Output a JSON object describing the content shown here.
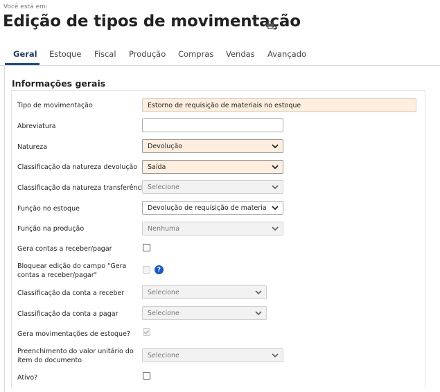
{
  "breadcrumb": "Você está em:",
  "page_title": "Edição de tipos de movimentação",
  "tabs": [
    {
      "label": "Geral"
    },
    {
      "label": "Estoque"
    },
    {
      "label": "Fiscal"
    },
    {
      "label": "Produção"
    },
    {
      "label": "Compras"
    },
    {
      "label": "Vendas"
    },
    {
      "label": "Avançado"
    }
  ],
  "section_title": "Informações gerais",
  "fields": {
    "tipo_movimentacao": {
      "label": "Tipo de movimentação",
      "value": "Estorno de requisição de materiais no estoque"
    },
    "abreviatura": {
      "label": "Abreviatura",
      "value": ""
    },
    "natureza": {
      "label": "Natureza",
      "value": "Devolução"
    },
    "class_natureza_devolucao": {
      "label": "Classificação da natureza devolução",
      "value": "Saída"
    },
    "class_natureza_transferencia": {
      "label": "Classificação da natureza transferência",
      "value": "Selecione"
    },
    "funcao_estoque": {
      "label": "Função no estoque",
      "value": "Devolução de requisição de materiais inde"
    },
    "funcao_producao": {
      "label": "Função na produção",
      "value": "Nenhuma"
    },
    "gera_contas": {
      "label": "Gera contas a receber/pagar",
      "checked": false
    },
    "bloquear_edicao": {
      "label_line1": "Bloquear edição do campo \"Gera",
      "label_line2": "contas a receber/pagar\"",
      "checked": false,
      "help": "?"
    },
    "class_conta_receber": {
      "label": "Classificação da conta a receber",
      "value": "Selecione"
    },
    "class_conta_pagar": {
      "label": "Classificação da conta a pagar",
      "value": "Selecione"
    },
    "gera_movimentacoes": {
      "label": "Gera movimentações de estoque?",
      "checked": true
    },
    "preenchimento_valor": {
      "label_line1": "Preenchimento do valor unitário do",
      "label_line2": "item do documento",
      "value": "Selecione"
    },
    "ativo": {
      "label": "Ativo?",
      "checked": false
    }
  },
  "icons": {
    "print": "print-icon",
    "chevron": "chevron-down-icon",
    "help": "help-icon"
  }
}
